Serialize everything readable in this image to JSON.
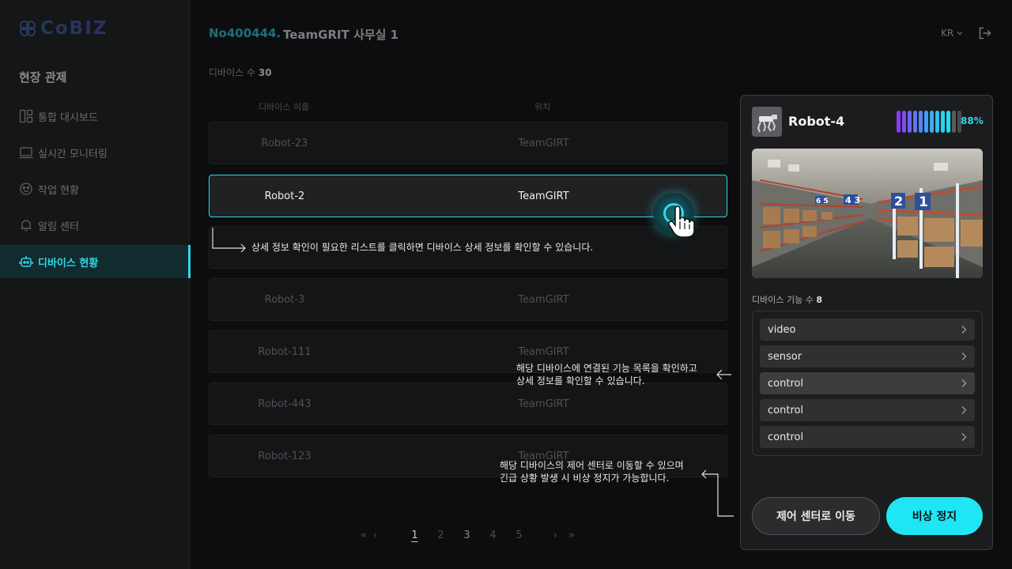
{
  "brand": {
    "logo_text": "CoBIZ"
  },
  "sidebar": {
    "section_title": "현장 관제",
    "items": [
      {
        "label": "통합 대시보드",
        "icon": "dashboard-icon"
      },
      {
        "label": "실시간 모니터링",
        "icon": "monitor-icon"
      },
      {
        "label": "작업 현황",
        "icon": "task-icon"
      },
      {
        "label": "알림 센터",
        "icon": "bell-icon"
      },
      {
        "label": "디바이스 현황",
        "icon": "robot-icon",
        "active": true
      }
    ]
  },
  "header": {
    "site_id": "No400444.",
    "site_name": "TeamGRIT 사무실 1",
    "lang": "KR"
  },
  "device_count": {
    "label": "디바이스 수",
    "value": "30"
  },
  "table": {
    "columns": [
      "디바이스 이름",
      "위치"
    ],
    "rows": [
      {
        "name": "Robot-23",
        "location": "TeamGIRT"
      },
      {
        "name": "Robot-2",
        "location": "TeamGIRT",
        "selected": true
      },
      {
        "name": "",
        "location": ""
      },
      {
        "name": "Robot-3",
        "location": "TeamGIRT"
      },
      {
        "name": "Robot-111",
        "location": "TeamGIRT"
      },
      {
        "name": "Robot-443",
        "location": "TeamGIRT"
      },
      {
        "name": "Robot-123",
        "location": "TeamGIRT"
      }
    ]
  },
  "pagination": {
    "pages": [
      "1",
      "2",
      "3",
      "4",
      "5"
    ],
    "current": "1"
  },
  "tips": {
    "list": "상세 정보 확인이 필요한 리스트를 클릭하면 디바이스 상세 정보를 확인할 수 있습니다.",
    "functions_line1": "해당 디바이스에 연결된 기능 목록을 확인하고",
    "functions_line2": "상세 정보를 확인할 수 있습니다.",
    "control_line1": "해당 디바이스의 제어 센터로 이동할 수 있으며",
    "control_line2": "긴급 상황 발생 시 비상 정지가 가능합니다."
  },
  "panel": {
    "title": "Robot-4",
    "battery_percent": "88%",
    "battery_level": 0.88,
    "functions_label": "디바이스 기능 수",
    "functions_count": "8",
    "functions": [
      {
        "label": "video"
      },
      {
        "label": "sensor"
      },
      {
        "label": "control",
        "highlighted": true
      },
      {
        "label": "control"
      },
      {
        "label": "control"
      }
    ],
    "btn_control": "제어 센터로 이동",
    "btn_stop": "비상 정지"
  },
  "colors": {
    "accent": "#2ed8e8",
    "background": "#0d0d0f",
    "panel": "#1b1c1d"
  }
}
